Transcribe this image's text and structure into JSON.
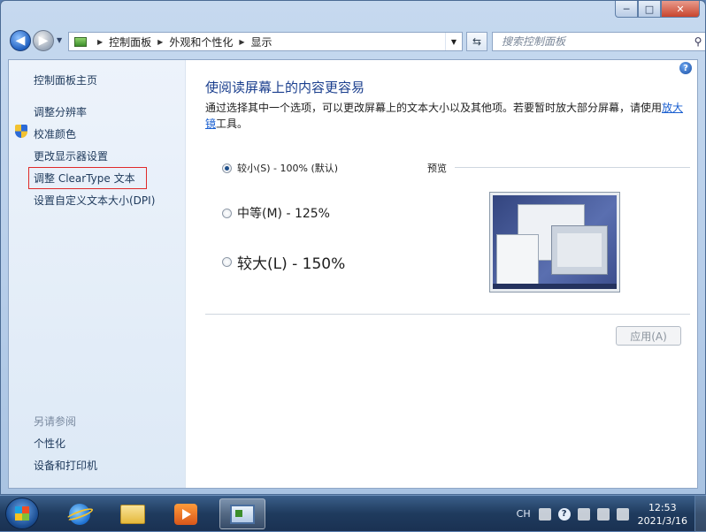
{
  "window": {
    "minimize": "─",
    "maximize": "□",
    "close": "✕"
  },
  "nav": {
    "breadcrumb": [
      "控制面板",
      "外观和个性化",
      "显示"
    ],
    "search_placeholder": "搜索控制面板"
  },
  "sidebar": {
    "home": "控制面板主页",
    "links": [
      "调整分辨率",
      "校准颜色",
      "更改显示器设置",
      "调整 ClearType 文本",
      "设置自定义文本大小(DPI)"
    ],
    "see_also_title": "另请参阅",
    "see_also": [
      "个性化",
      "设备和打印机"
    ]
  },
  "main": {
    "heading": "使阅读屏幕上的内容更容易",
    "intro": "通过选择其中一个选项，可以更改屏幕上的文本大小以及其他项。若要暂时放大部分屏幕，请使用",
    "intro_link": "放大镜",
    "intro_tail": "工具。",
    "options": [
      {
        "label": "较小(S) - 100% (默认)",
        "checked": true
      },
      {
        "label": "中等(M) - 125%",
        "checked": false
      },
      {
        "label": "较大(L) - 150%",
        "checked": false
      }
    ],
    "preview_label": "预览",
    "apply": "应用(A)"
  },
  "taskbar": {
    "lang": "CH",
    "time": "12:53",
    "date": "2021/3/16"
  },
  "colors": {
    "heading": "#1b3f8e",
    "link": "#1a5fd0",
    "highlight_box": "#e02a2a"
  },
  "icons": [
    "back-arrow-icon",
    "forward-arrow-icon",
    "control-panel-icon",
    "refresh-icon",
    "search-icon",
    "help-icon",
    "shield-icon",
    "windows-start-icon",
    "internet-explorer-icon",
    "folder-icon",
    "media-player-icon"
  ]
}
